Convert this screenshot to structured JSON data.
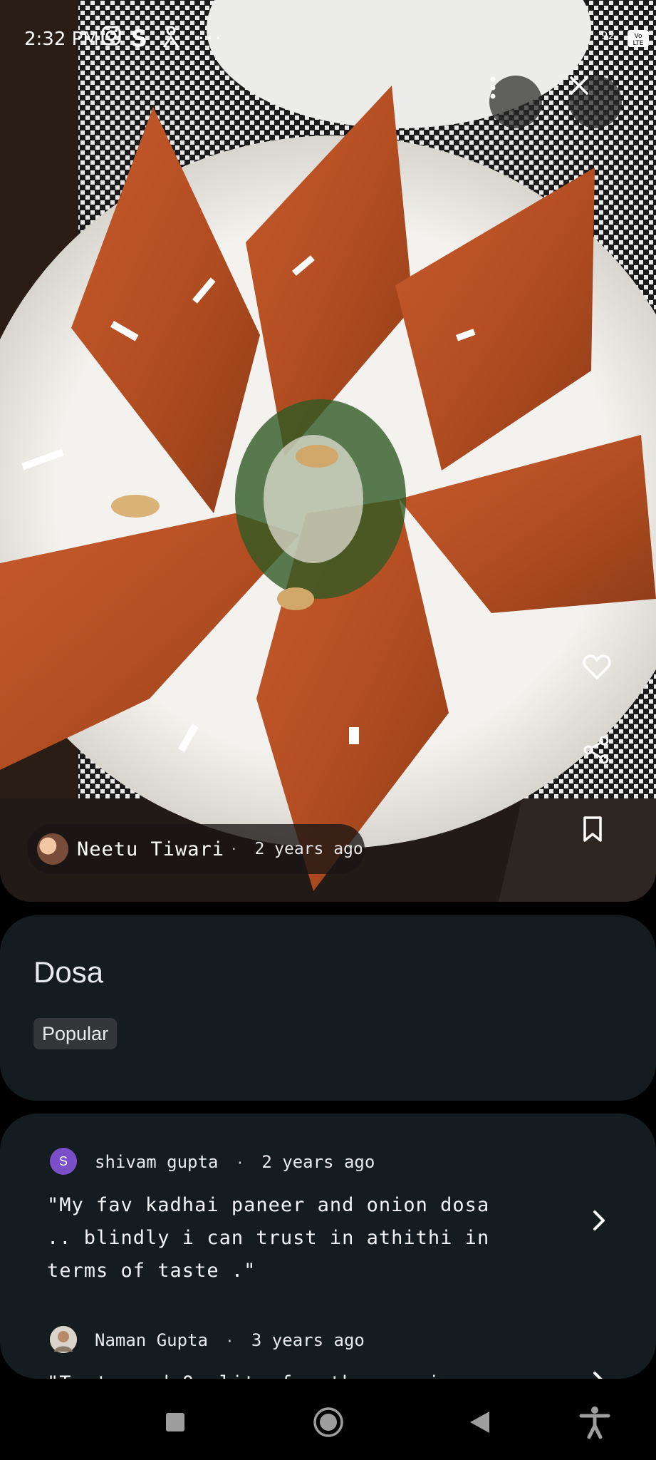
{
  "status_bar": {
    "time": "2:32 PM",
    "network": "4G",
    "volte": "Vo LTE",
    "battery": "92"
  },
  "photo": {
    "author_name": "Neetu Tiwari",
    "posted": "2 years ago"
  },
  "dish": {
    "title": "Dosa",
    "tag": "Popular"
  },
  "reviews": [
    {
      "avatar_letter": "S",
      "avatar_color": "#7b4fc9",
      "author": "shivam gupta",
      "posted": "2 years ago",
      "text": "\"My fav kadhai paneer and onion dosa .. blindly i can trust in athithi in terms of taste .\""
    },
    {
      "avatar_letter": "",
      "avatar_color": "#c9b49a",
      "author": "Naman Gupta",
      "posted": "3 years ago",
      "text": "\"Taste and Quality for the service provided is"
    }
  ],
  "icons": {
    "more": "more-vert-icon",
    "close": "close-icon",
    "like": "heart-icon",
    "share": "share-icon",
    "save": "bookmark-icon",
    "chevron": "chevron-right-icon"
  }
}
